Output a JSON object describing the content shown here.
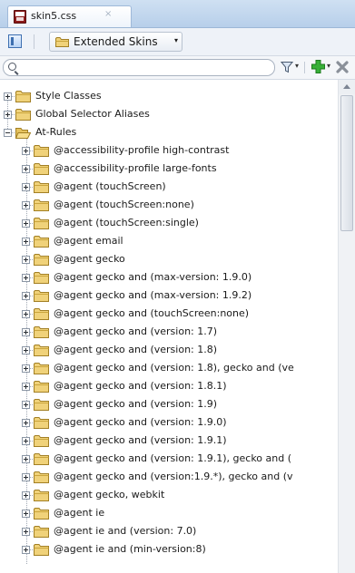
{
  "tab": {
    "title": "skin5.css",
    "close_glyph": "×",
    "file_icon": "css-file-icon"
  },
  "toolbar": {
    "skins_label": "Extended Skins",
    "skins_caret": "▾"
  },
  "search": {
    "value": "",
    "placeholder": ""
  },
  "actions": {
    "filter_caret": "▾",
    "add_caret": "▾"
  },
  "colors": {
    "accent": "#3d6fb0",
    "folder": "#e8c96a",
    "add_green": "#2e9e2e",
    "tab_strip": "#c3d8ef"
  },
  "tree": {
    "items": [
      {
        "label": "Style Classes",
        "level": 0,
        "expanded": false
      },
      {
        "label": "Global Selector Aliases",
        "level": 0,
        "expanded": false
      },
      {
        "label": "At-Rules",
        "level": 0,
        "expanded": true
      },
      {
        "label": "@accessibility-profile high-contrast",
        "level": 1,
        "expanded": false
      },
      {
        "label": "@accessibility-profile large-fonts",
        "level": 1,
        "expanded": false
      },
      {
        "label": "@agent (touchScreen)",
        "level": 1,
        "expanded": false
      },
      {
        "label": "@agent (touchScreen:none)",
        "level": 1,
        "expanded": false
      },
      {
        "label": "@agent (touchScreen:single)",
        "level": 1,
        "expanded": false
      },
      {
        "label": "@agent email",
        "level": 1,
        "expanded": false
      },
      {
        "label": "@agent gecko",
        "level": 1,
        "expanded": false
      },
      {
        "label": "@agent gecko and (max-version: 1.9.0)",
        "level": 1,
        "expanded": false
      },
      {
        "label": "@agent gecko and (max-version: 1.9.2)",
        "level": 1,
        "expanded": false
      },
      {
        "label": "@agent gecko and (touchScreen:none)",
        "level": 1,
        "expanded": false
      },
      {
        "label": "@agent gecko and (version: 1.7)",
        "level": 1,
        "expanded": false
      },
      {
        "label": "@agent gecko and (version: 1.8)",
        "level": 1,
        "expanded": false
      },
      {
        "label": "@agent gecko and (version: 1.8), gecko and (ve",
        "level": 1,
        "expanded": false
      },
      {
        "label": "@agent gecko and (version: 1.8.1)",
        "level": 1,
        "expanded": false
      },
      {
        "label": "@agent gecko and (version: 1.9)",
        "level": 1,
        "expanded": false
      },
      {
        "label": "@agent gecko and (version: 1.9.0)",
        "level": 1,
        "expanded": false
      },
      {
        "label": "@agent gecko and (version: 1.9.1)",
        "level": 1,
        "expanded": false
      },
      {
        "label": "@agent gecko and (version: 1.9.1), gecko and (",
        "level": 1,
        "expanded": false
      },
      {
        "label": "@agent gecko and (version:1.9.*), gecko and (v",
        "level": 1,
        "expanded": false
      },
      {
        "label": "@agent gecko, webkit",
        "level": 1,
        "expanded": false
      },
      {
        "label": "@agent ie",
        "level": 1,
        "expanded": false
      },
      {
        "label": "@agent ie  and (version: 7.0)",
        "level": 1,
        "expanded": false
      },
      {
        "label": "@agent ie and (min-version:8)",
        "level": 1,
        "expanded": false
      }
    ]
  }
}
